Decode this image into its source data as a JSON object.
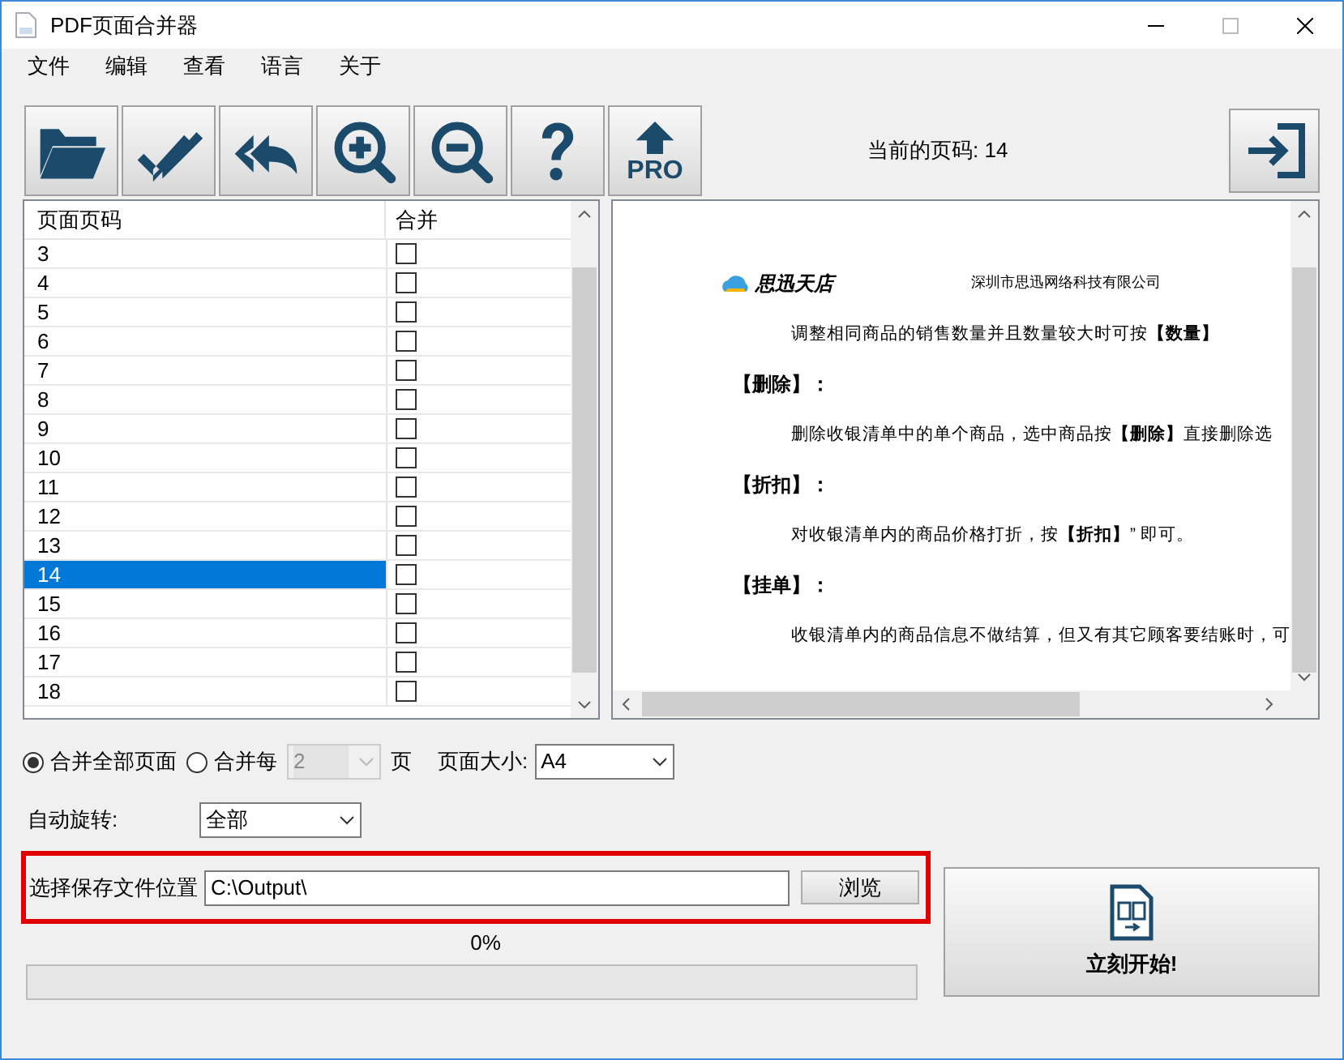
{
  "window": {
    "title": "PDF页面合并器"
  },
  "menu": [
    "文件",
    "编辑",
    "查看",
    "语言",
    "关于"
  ],
  "toolbar": [
    {
      "kind": "open"
    },
    {
      "kind": "check"
    },
    {
      "kind": "undo"
    },
    {
      "kind": "zoom_in"
    },
    {
      "kind": "zoom_out"
    },
    {
      "kind": "help"
    },
    {
      "kind": "pro",
      "label": "PRO"
    }
  ],
  "current_page": "当前的页码: 14",
  "page_list": {
    "columns": [
      "页面页码",
      "合并"
    ],
    "rows": [
      {
        "page": "3",
        "checked": false,
        "selected": false
      },
      {
        "page": "4",
        "checked": false,
        "selected": false
      },
      {
        "page": "5",
        "checked": false,
        "selected": false
      },
      {
        "page": "6",
        "checked": false,
        "selected": false
      },
      {
        "page": "7",
        "checked": false,
        "selected": false
      },
      {
        "page": "8",
        "checked": false,
        "selected": false
      },
      {
        "page": "9",
        "checked": false,
        "selected": false
      },
      {
        "page": "10",
        "checked": false,
        "selected": false
      },
      {
        "page": "11",
        "checked": false,
        "selected": false
      },
      {
        "page": "12",
        "checked": false,
        "selected": false
      },
      {
        "page": "13",
        "checked": false,
        "selected": false
      },
      {
        "page": "14",
        "checked": false,
        "selected": true
      },
      {
        "page": "15",
        "checked": false,
        "selected": false
      },
      {
        "page": "16",
        "checked": false,
        "selected": false
      },
      {
        "page": "17",
        "checked": false,
        "selected": false
      },
      {
        "page": "18",
        "checked": false,
        "selected": false
      }
    ]
  },
  "preview": {
    "logo": "思迅天店",
    "company": "深圳市思迅网络科技有限公司",
    "lines": [
      {
        "kind": "body",
        "text": "调整相同商品的销售数量并且数量较大时可按**【数量】**"
      },
      {
        "kind": "heading",
        "text": "【删除】："
      },
      {
        "kind": "body",
        "text": "删除收银清单中的单个商品，选中商品按**【删除】**直接删除选"
      },
      {
        "kind": "heading",
        "text": "【折扣】："
      },
      {
        "kind": "body",
        "text": "对收银清单内的商品价格打折，按**【折扣】**” 即可。"
      },
      {
        "kind": "heading",
        "text": "【挂单】："
      },
      {
        "kind": "body",
        "text": "收银清单内的商品信息不做结算，但又有其它顾客要结账时，可"
      }
    ]
  },
  "merge_mode": [
    {
      "label": "合并全部页面",
      "selected": true
    },
    {
      "label": "合并每",
      "selected": false
    }
  ],
  "pages_per": {
    "value": "2",
    "disabled": true
  },
  "pages_unit": "页",
  "page_size": {
    "label": "页面大小:",
    "value": "A4"
  },
  "auto_rotate": {
    "label": "自动旋转:",
    "value": "全部"
  },
  "save_location": {
    "label": "选择保存文件位置",
    "value": "C:\\Output\\",
    "browse": "浏览"
  },
  "progress": {
    "text": "0%",
    "level": 0
  },
  "start_button": "立刻开始!"
}
